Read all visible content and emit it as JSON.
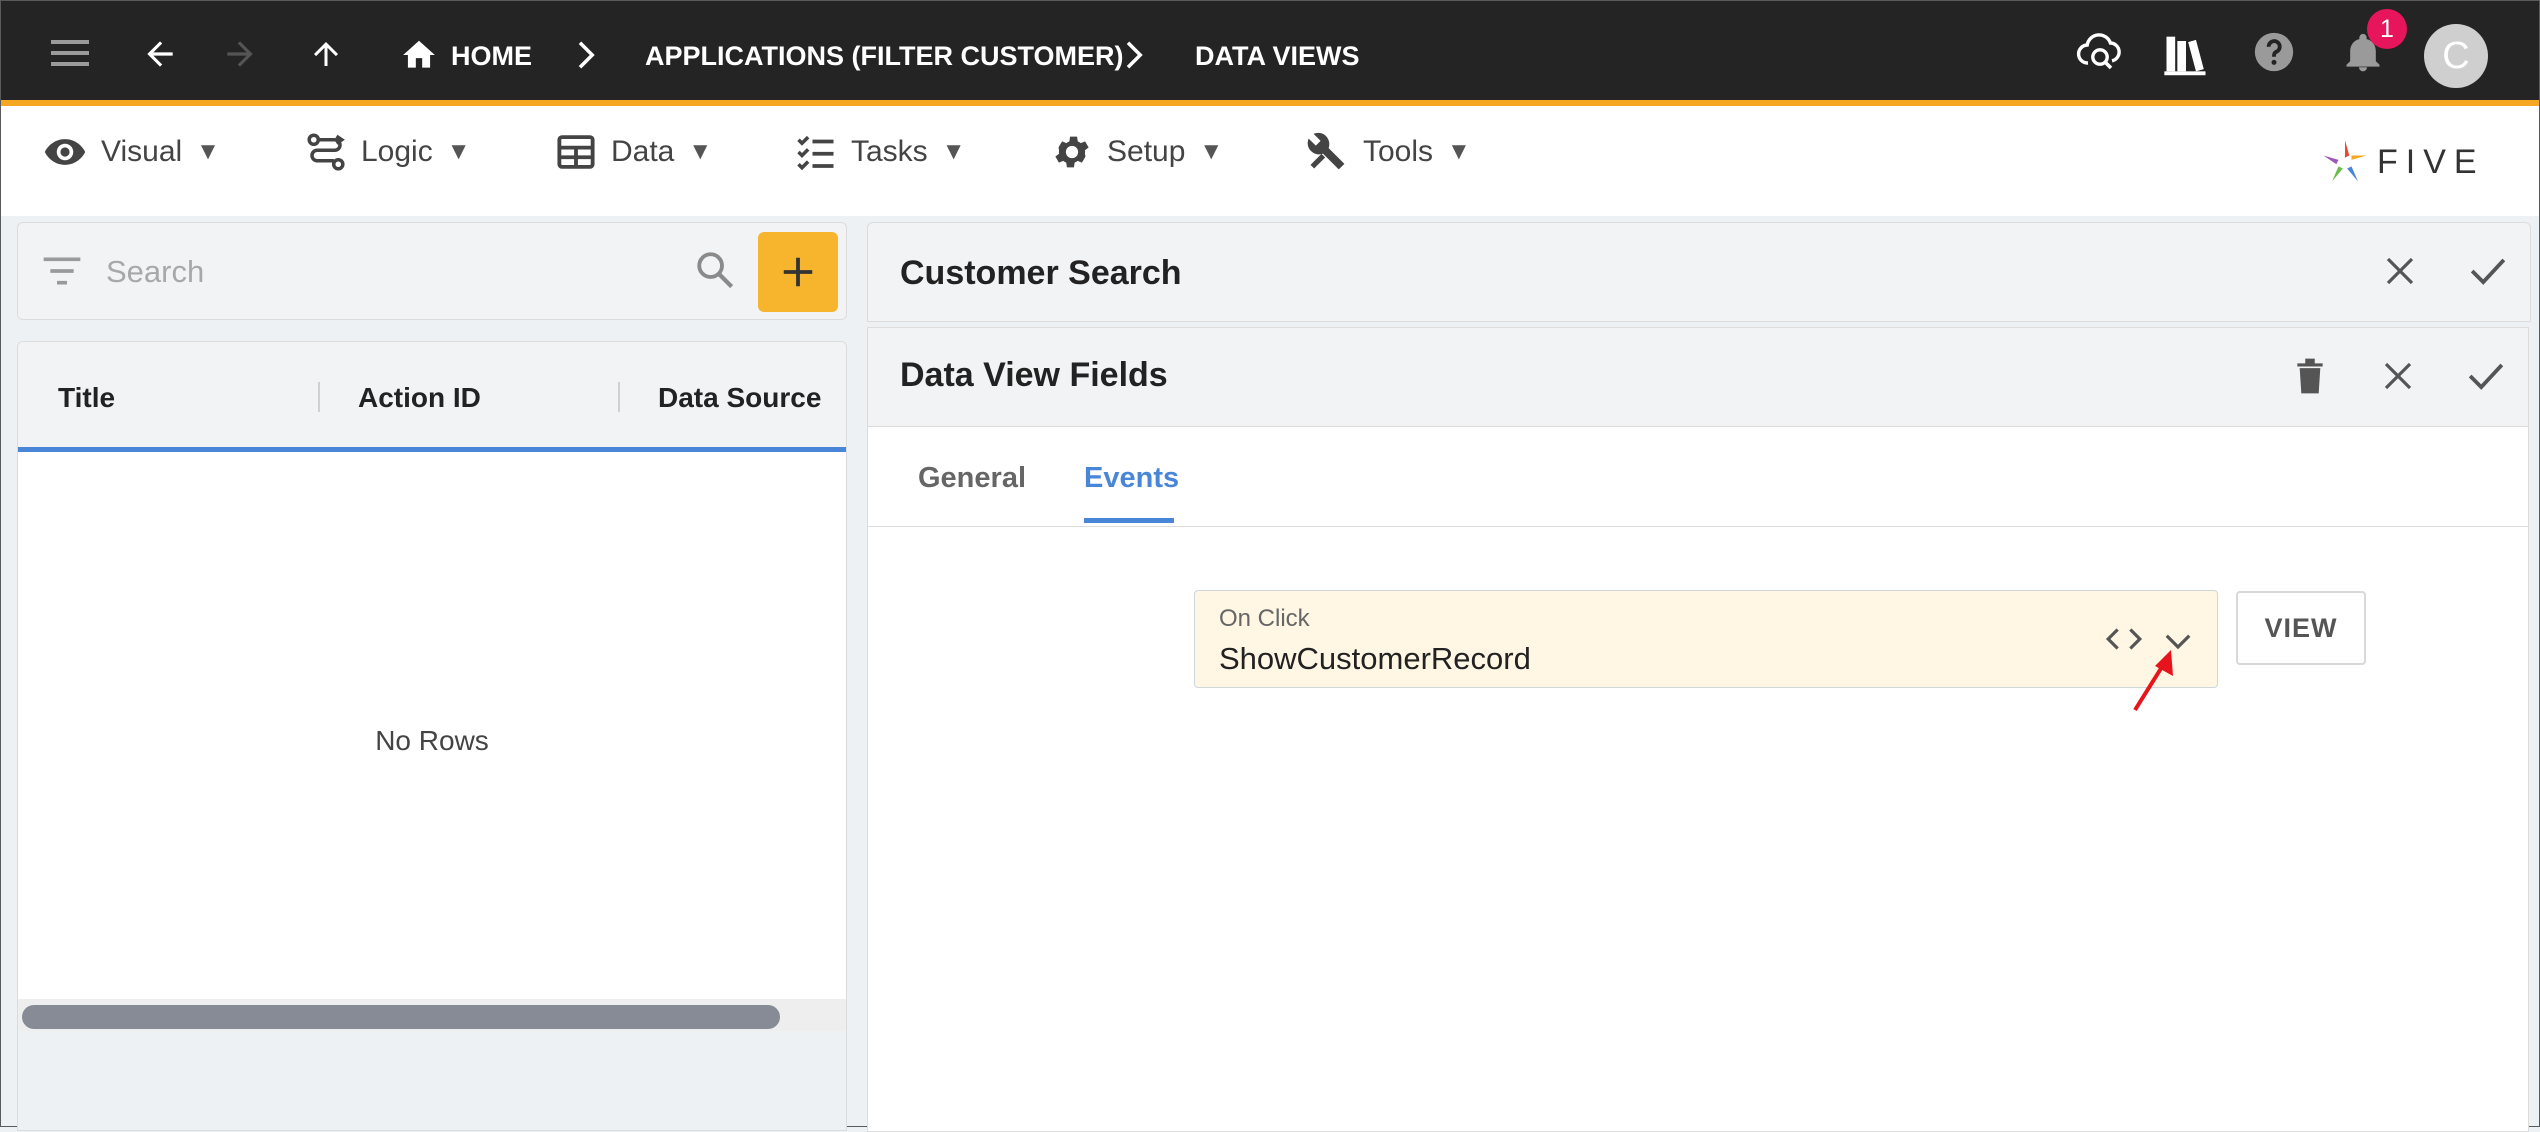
{
  "topbar": {
    "breadcrumb": {
      "home": "HOME",
      "applications": "APPLICATIONS (FILTER CUSTOMER)",
      "data_views": "DATA VIEWS"
    },
    "notification_count": "1",
    "avatar_initial": "C"
  },
  "menu": {
    "items": [
      {
        "label": "Visual",
        "icon": "eye-icon"
      },
      {
        "label": "Logic",
        "icon": "logic-icon"
      },
      {
        "label": "Data",
        "icon": "table-icon"
      },
      {
        "label": "Tasks",
        "icon": "checklist-icon"
      },
      {
        "label": "Setup",
        "icon": "gear-icon"
      },
      {
        "label": "Tools",
        "icon": "tools-icon"
      }
    ],
    "caret": "▼",
    "logo_text": "FIVE"
  },
  "list": {
    "search_placeholder": "Search",
    "columns": [
      "Title",
      "Action ID",
      "Data Source"
    ],
    "empty_text": "No Rows"
  },
  "record": {
    "title": "Customer Search"
  },
  "sub_record": {
    "title": "Data View Fields",
    "tabs": [
      "General",
      "Events"
    ],
    "active_tab": "Events",
    "event": {
      "label": "On Click",
      "value": "ShowCustomerRecord"
    },
    "view_button": "VIEW"
  },
  "colors": {
    "topbar_bg": "#242424",
    "accent_orange": "#f5a623",
    "add_button": "#f6b52d",
    "active_blue": "#4a86d8",
    "field_bg": "#fff6e3",
    "badge": "#e6155c",
    "annotation_arrow": "#e8141b"
  }
}
